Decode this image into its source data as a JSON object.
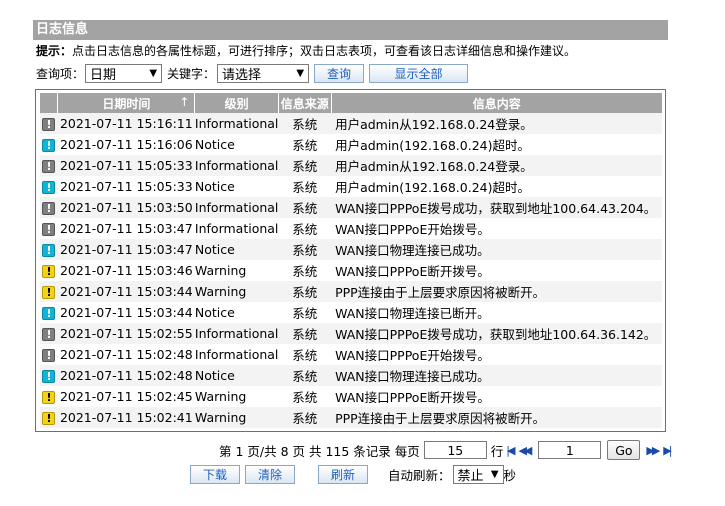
{
  "header": {
    "title": "日志信息"
  },
  "hint": {
    "label": "提示：",
    "text": "点击日志信息的各属性标题，可进行排序；双击日志表项，可查看该日志详细信息和操作建议。"
  },
  "query": {
    "field_label": "查询项：",
    "field_value": "日期",
    "keyword_label": "关键字：",
    "keyword_value": "请选择",
    "search_button": "查询",
    "show_all_button": "显示全部"
  },
  "table": {
    "columns": {
      "time": "日期时间",
      "sort_indicator": "↑",
      "level": "级别",
      "source": "信息来源",
      "content": "信息内容"
    },
    "rows": [
      {
        "icon": "!",
        "level_type": "info",
        "time": "2021-07-11 15:16:11",
        "level": "Informational",
        "source": "系统",
        "message": "用户admin从192.168.0.24登录。"
      },
      {
        "icon": "!",
        "level_type": "notice",
        "time": "2021-07-11 15:16:06",
        "level": "Notice",
        "source": "系统",
        "message": "用户admin(192.168.0.24)超时。"
      },
      {
        "icon": "!",
        "level_type": "info",
        "time": "2021-07-11 15:05:33",
        "level": "Informational",
        "source": "系统",
        "message": "用户admin从192.168.0.24登录。"
      },
      {
        "icon": "!",
        "level_type": "notice",
        "time": "2021-07-11 15:05:33",
        "level": "Notice",
        "source": "系统",
        "message": "用户admin(192.168.0.24)超时。"
      },
      {
        "icon": "!",
        "level_type": "info",
        "time": "2021-07-11 15:03:50",
        "level": "Informational",
        "source": "系统",
        "message": "WAN接口PPPoE拨号成功，获取到地址100.64.43.204。"
      },
      {
        "icon": "!",
        "level_type": "info",
        "time": "2021-07-11 15:03:47",
        "level": "Informational",
        "source": "系统",
        "message": "WAN接口PPPoE开始拨号。"
      },
      {
        "icon": "!",
        "level_type": "notice",
        "time": "2021-07-11 15:03:47",
        "level": "Notice",
        "source": "系统",
        "message": "WAN接口物理连接已成功。"
      },
      {
        "icon": "!",
        "level_type": "warning",
        "time": "2021-07-11 15:03:46",
        "level": "Warning",
        "source": "系统",
        "message": "WAN接口PPPoE断开拨号。"
      },
      {
        "icon": "!",
        "level_type": "warning",
        "time": "2021-07-11 15:03:44",
        "level": "Warning",
        "source": "系统",
        "message": "PPP连接由于上层要求原因将被断开。"
      },
      {
        "icon": "!",
        "level_type": "notice",
        "time": "2021-07-11 15:03:44",
        "level": "Notice",
        "source": "系统",
        "message": "WAN接口物理连接已断开。"
      },
      {
        "icon": "!",
        "level_type": "info",
        "time": "2021-07-11 15:02:55",
        "level": "Informational",
        "source": "系统",
        "message": "WAN接口PPPoE拨号成功，获取到地址100.64.36.142。"
      },
      {
        "icon": "!",
        "level_type": "info",
        "time": "2021-07-11 15:02:48",
        "level": "Informational",
        "source": "系统",
        "message": "WAN接口PPPoE开始拨号。"
      },
      {
        "icon": "!",
        "level_type": "notice",
        "time": "2021-07-11 15:02:48",
        "level": "Notice",
        "source": "系统",
        "message": "WAN接口物理连接已成功。"
      },
      {
        "icon": "!",
        "level_type": "warning",
        "time": "2021-07-11 15:02:45",
        "level": "Warning",
        "source": "系统",
        "message": "WAN接口PPPoE断开拨号。"
      },
      {
        "icon": "!",
        "level_type": "warning",
        "time": "2021-07-11 15:02:41",
        "level": "Warning",
        "source": "系统",
        "message": "PPP连接由于上层要求原因将被断开。"
      }
    ]
  },
  "pager": {
    "prefix": "第 1 页/共 8 页 共 115 条记录 每页",
    "per_page": "15",
    "rows_label": "行",
    "page": "1",
    "go_button": "Go",
    "first_icon": "|◀",
    "prev_icon": "◀◀",
    "next_icon": "▶▶",
    "last_icon": "▶|"
  },
  "actions": {
    "download": "下载",
    "clear": "清除",
    "refresh": "刷新",
    "auto_refresh_label": "自动刷新：",
    "auto_refresh_value": "禁止",
    "seconds_label": "秒"
  },
  "colors": {
    "header_bg": "#a3a3a3",
    "info": "#7f7f7f",
    "notice": "#12b4d6",
    "warning": "#f2d21b",
    "link": "#1f5fbf"
  }
}
